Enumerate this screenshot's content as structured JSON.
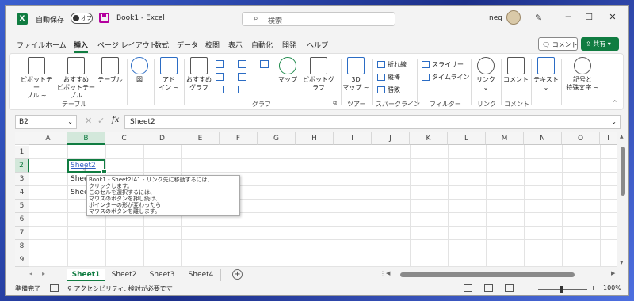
{
  "titlebar": {
    "autosave_label": "自動保存",
    "autosave_state": "オフ",
    "doc_title": "Book1  -  Excel",
    "search_placeholder": "検索",
    "user_name": "neg"
  },
  "menu": [
    "ファイル",
    "ホーム",
    "挿入",
    "ページ レイアウト",
    "数式",
    "データ",
    "校閲",
    "表示",
    "自動化",
    "開発",
    "ヘルプ"
  ],
  "menu_active": "挿入",
  "comment_button": "コメント",
  "share_button": "共有",
  "ribbon": {
    "pivot_label1": "ピボットテー",
    "pivot_label2": "ブル ~",
    "rec_pivot_label1": "おすすめ",
    "rec_pivot_label2": "ピボットテーブル",
    "table_label": "テーブル",
    "fig_label": "図",
    "addin_label1": "アド",
    "addin_label2": "イン ~",
    "rec_chart_label1": "おすすめ",
    "rec_chart_label2": "グラフ",
    "map_label": "マップ",
    "pivotchart_label": "ピボットグラフ",
    "map3d_label1": "3D",
    "map3d_label2": "マップ ~",
    "line_label": "折れ線",
    "column_label": "縦棒",
    "winloss_label": "勝敗",
    "slicer_label": "スライサー",
    "timeline_label": "タイムライン",
    "link_label1": "リンク",
    "comment_label": "コメント",
    "text_label": "テキスト",
    "symbol_label1": "記号と",
    "symbol_label2": "特殊文字 ~",
    "groups": {
      "table": "テーブル",
      "chart": "グラフ",
      "tour": "ツアー",
      "sparkline": "スパークライン",
      "filter": "フィルター",
      "link": "リンク",
      "comment": "コメント"
    }
  },
  "formula_bar": {
    "name_box": "B2",
    "formula": "Sheet2"
  },
  "grid": {
    "columns": [
      "A",
      "B",
      "C",
      "D",
      "E",
      "F",
      "G",
      "H",
      "I",
      "J",
      "K",
      "L",
      "M",
      "N",
      "O",
      "I"
    ],
    "rows": [
      "1",
      "2",
      "3",
      "4",
      "5",
      "6",
      "7",
      "8",
      "9",
      "10"
    ],
    "b2": "Sheet2",
    "b3": "Shee",
    "b4": "Shee"
  },
  "tooltip": [
    "Book1 - Sheet2!A1 - リンク先に移動するには、",
    "クリックします。",
    "このセルを選択するには、",
    "マウスのボタンを押し続け、",
    "ポインターの形が変わったら",
    "マウスのボタンを離します。"
  ],
  "sheets": [
    "Sheet1",
    "Sheet2",
    "Sheet3",
    "Sheet4"
  ],
  "status": {
    "ready": "準備完了",
    "accessibility": "アクセシビリティ: 検討が必要です",
    "zoom": "100%"
  }
}
